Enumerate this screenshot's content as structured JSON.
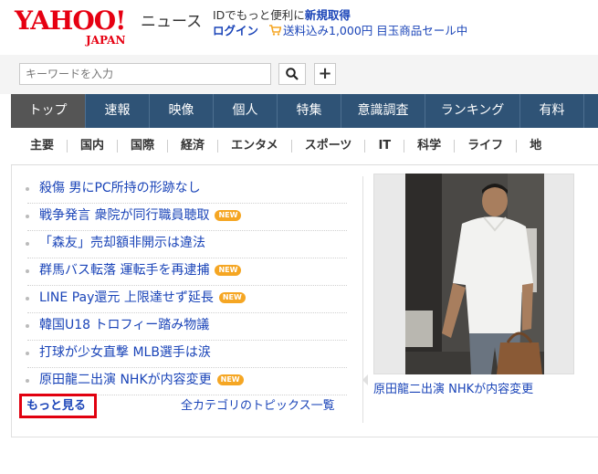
{
  "header": {
    "logo_main": "YAHOO!",
    "logo_sub": "JAPAN",
    "service_name": "ニュース",
    "promo_prefix": "IDでもっと便利に",
    "promo_strong": "新規取得",
    "login_label": "ログイン",
    "promo_link": "送料込み1,000円 目玉商品セール中",
    "cart_icon": "cart-icon"
  },
  "search": {
    "placeholder": "キーワードを入力",
    "search_icon": "search-icon",
    "plus_label": "+"
  },
  "main_nav": [
    {
      "label": "トップ",
      "active": true
    },
    {
      "label": "速報"
    },
    {
      "label": "映像"
    },
    {
      "label": "個人"
    },
    {
      "label": "特集"
    },
    {
      "label": "意識調査"
    },
    {
      "label": "ランキング"
    },
    {
      "label": "有料"
    }
  ],
  "sub_nav": [
    {
      "label": "主要",
      "active": true
    },
    {
      "label": "国内"
    },
    {
      "label": "国際"
    },
    {
      "label": "経済"
    },
    {
      "label": "エンタメ"
    },
    {
      "label": "スポーツ"
    },
    {
      "label": "IT"
    },
    {
      "label": "科学"
    },
    {
      "label": "ライフ"
    },
    {
      "label": "地"
    }
  ],
  "topics": [
    {
      "title": "殺傷 男にPC所持の形跡なし",
      "new": false
    },
    {
      "title": "戦争発言 衆院が同行職員聴取",
      "new": true
    },
    {
      "title": "「森友」売却額非開示は違法",
      "new": false
    },
    {
      "title": "群馬バス転落 運転手を再逮捕",
      "new": true
    },
    {
      "title": "LINE Pay還元 上限達せず延長",
      "new": true
    },
    {
      "title": "韓国U18 トロフィー踏み物議",
      "new": false
    },
    {
      "title": "打球が少女直撃 MLB選手は涙",
      "new": false
    },
    {
      "title": "原田龍二出演 NHKが内容変更",
      "new": true
    }
  ],
  "new_badge_label": "NEW",
  "more_label": "もっと見る",
  "all_topics_label": "全カテゴリのトピックス一覧",
  "photo_caption": "原田龍二出演 NHKが内容変更",
  "colors": {
    "logo_red": "#e60012",
    "nav_bg": "#2f5376",
    "nav_active": "#555555",
    "link": "#1a44b8",
    "new_badge": "#f5a623",
    "highlight_box": "#e1000f"
  }
}
